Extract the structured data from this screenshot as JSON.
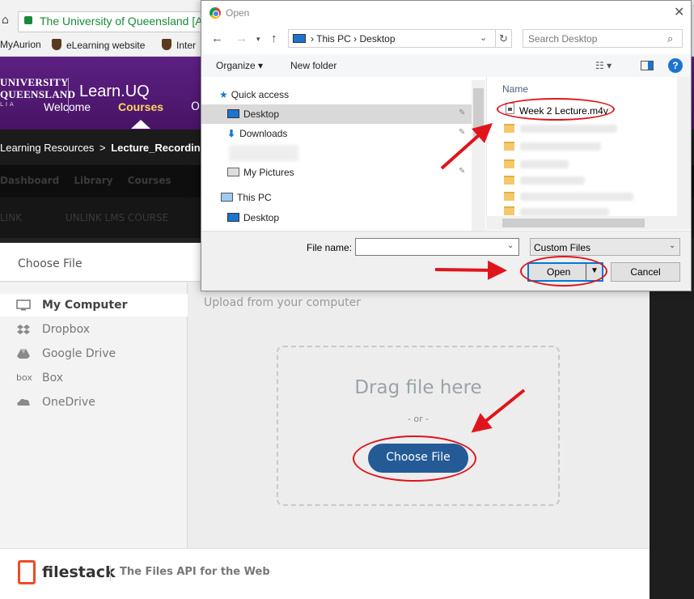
{
  "browser": {
    "address_text": "The University of Queensland [A",
    "bookmarks": [
      "MyAurion",
      "eLearning website",
      "Inter"
    ]
  },
  "uq": {
    "logo_line1": "UNIVERSITY",
    "logo_line2": "QUEENSLAND",
    "logo_sub": "LIA",
    "site_name": "Learn.UQ",
    "nav_welcome": "Welcome",
    "nav_courses": "Courses",
    "nav_other": "O",
    "breadcrumb_1": "Learning Resources",
    "breadcrumb_sep": ">",
    "breadcrumb_2": "Lecture_Recordings",
    "dark_nav": [
      "Dashboard",
      "Library",
      "Courses"
    ],
    "dark_nav2": [
      "LINK",
      "UNLINK LMS COURSE"
    ]
  },
  "filestack": {
    "title": "Choose File",
    "sources": [
      {
        "label": "My Computer",
        "icon": "monitor-icon"
      },
      {
        "label": "Dropbox",
        "icon": "dropbox-icon"
      },
      {
        "label": "Google Drive",
        "icon": "google-drive-icon"
      },
      {
        "label": "Box",
        "icon": "box-icon",
        "icon_text": "box"
      },
      {
        "label": "OneDrive",
        "icon": "onedrive-icon"
      }
    ],
    "upload_label": "Upload from your computer",
    "drag_text": "Drag file here",
    "or_text": "- or -",
    "choose_button": "Choose File",
    "brand": "filestack",
    "tagline": "The Files API for the Web"
  },
  "dialog": {
    "title": "Open",
    "close": "✕",
    "path": [
      "This PC",
      "Desktop"
    ],
    "search_placeholder": "Search Desktop",
    "organize": "Organize ▾",
    "new_folder": "New folder",
    "nav_items": [
      {
        "label": "Quick access",
        "icon": "star-icon"
      },
      {
        "label": "Desktop",
        "icon": "desktop-icon"
      },
      {
        "label": "Downloads",
        "icon": "download-icon"
      },
      {
        "label": "My Pictures",
        "icon": "pictures-icon"
      },
      {
        "label": "This PC",
        "icon": "pc-icon"
      },
      {
        "label": "Desktop",
        "icon": "desktop-icon"
      }
    ],
    "name_header": "Name",
    "selected_file": "Week 2 Lecture.m4v",
    "filename_label": "File name:",
    "filename_value": "",
    "filter_value": "Custom Files",
    "open_button": "Open",
    "cancel_button": "Cancel"
  },
  "colors": {
    "uq_purple": "#51247a",
    "courses_gold": "#ffd75e",
    "filestack_button": "#245b96",
    "annotation_red": "#e0141c",
    "windows_accent": "#0078d7"
  }
}
